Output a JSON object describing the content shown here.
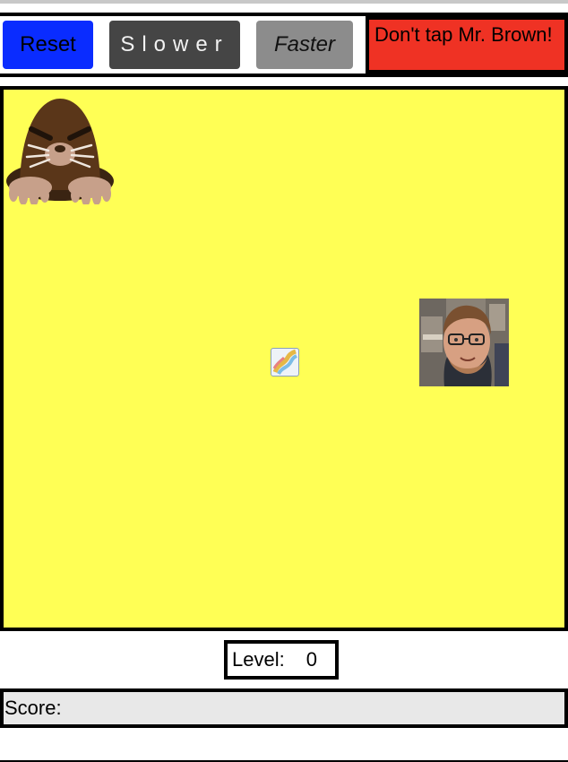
{
  "toolbar": {
    "reset_label": "Reset",
    "slower_label": "Slower",
    "faster_label": "Faster",
    "warning_text": "Don't tap Mr. Brown!"
  },
  "game": {
    "background_color": "#ffff55",
    "mole_icon": "mole-icon",
    "small_image_icon": "broken-image-icon",
    "face_icon": "mr-brown-photo"
  },
  "status": {
    "level_label": "Level:",
    "level_value": "0",
    "score_label": "Score:"
  },
  "colors": {
    "reset": "#0a2cff",
    "slower": "#454545",
    "faster": "#8c8c8c",
    "warning": "#ef3224"
  }
}
